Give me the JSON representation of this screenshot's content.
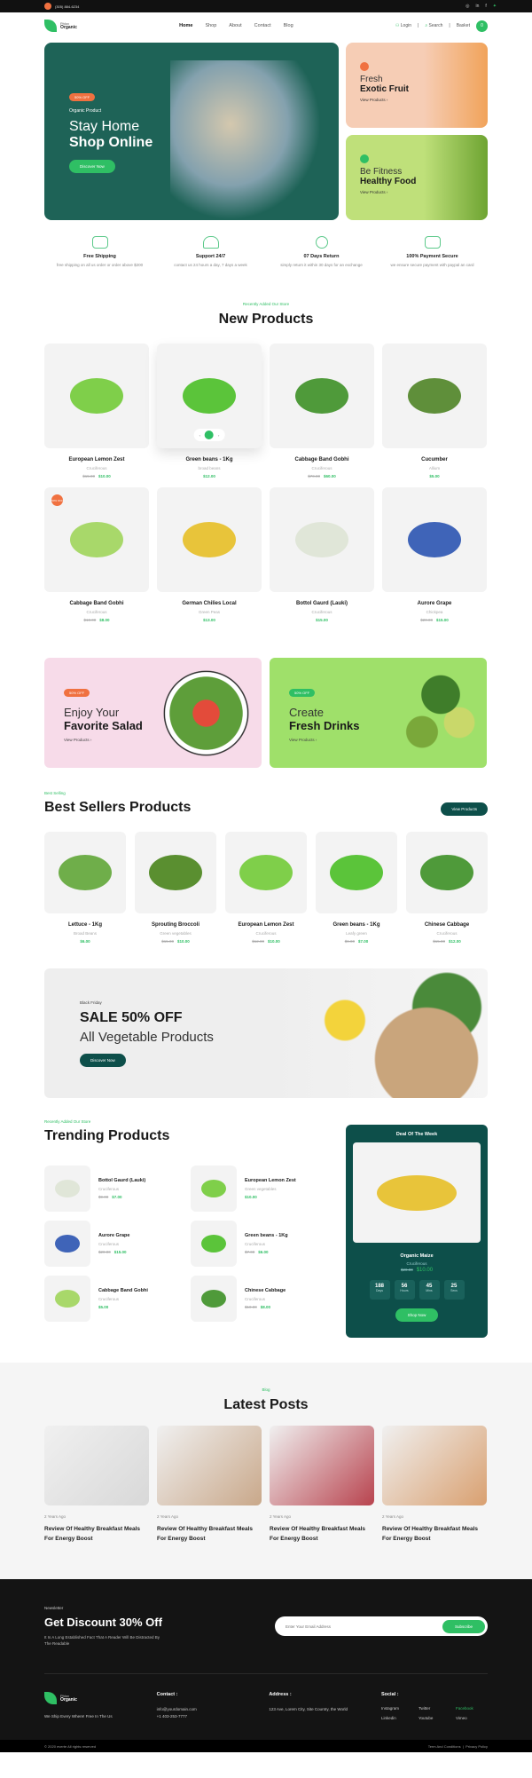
{
  "topbar": {
    "phone": "(305) 884-6234",
    "social": [
      "instagram-icon",
      "linkedin-icon",
      "facebook-icon",
      "twitter-icon"
    ]
  },
  "header": {
    "logo_top": "Phlox",
    "logo_bottom": "Organic",
    "nav": [
      "Home",
      "Shop",
      "About",
      "Contact",
      "Blog"
    ],
    "login": "Login",
    "search": "Search",
    "basket": "Basket",
    "basket_count": "0"
  },
  "hero": {
    "badge": "50% OFF",
    "subtitle": "Organic Product",
    "title1": "Stay Home",
    "title2": "Shop Online",
    "cta": "Discover Now"
  },
  "side_cards": [
    {
      "line1": "Fresh",
      "line2": "Exotic Fruit",
      "link": "View Products ›"
    },
    {
      "line1": "Be Fitness",
      "line2": "Healthy Food",
      "link": "View Products ›"
    }
  ],
  "features": [
    {
      "title": "Free Shipping",
      "desc": "free shipping on all us order or order above $200"
    },
    {
      "title": "Support 24/7",
      "desc": "contact us 24 hours a day, 7 days a week"
    },
    {
      "title": "07 Days Return",
      "desc": "simply return it within 30 days for an exchange"
    },
    {
      "title": "100% Payment Secure",
      "desc": "we ensure secure payment with paypal an card"
    }
  ],
  "new_products": {
    "eyebrow": "Recently Added Our Store",
    "title": "New Products",
    "items": [
      {
        "name": "European Lemon Zest",
        "cat": "Cruciferous",
        "old": "$15.00",
        "price": "$10.00",
        "color": "#7fcf4a"
      },
      {
        "name": "Green beans - 1Kg",
        "cat": "broad beans",
        "old": "",
        "price": "$12.00",
        "color": "#5bc43a"
      },
      {
        "name": "Cabbage Band Gobhi",
        "cat": "Cruciferous",
        "old": "$70.00",
        "price": "$60.00",
        "color": "#4f9a3a"
      },
      {
        "name": "Cucumber",
        "cat": "Allium",
        "old": "",
        "price": "$5.00",
        "color": "#5f8f3a"
      },
      {
        "name": "Cabbage Band Gobhi",
        "cat": "Cruciferous",
        "old": "$10.00",
        "price": "$8.00",
        "color": "#a8d86a",
        "sale": "50% OFF"
      },
      {
        "name": "German Chilies Local",
        "cat": "Green Peas",
        "old": "",
        "price": "$13.00",
        "color": "#e8c43a"
      },
      {
        "name": "Bottol Gaurd (Lauki)",
        "cat": "Cruciferous",
        "old": "",
        "price": "$15.00",
        "color": "#e0e6d8"
      },
      {
        "name": "Aurore Grape",
        "cat": "Chickpea",
        "old": "$20.00",
        "price": "$15.00",
        "color": "#3f64b8"
      }
    ],
    "controls": [
      "‹",
      "›"
    ]
  },
  "promos": [
    {
      "badge": "50% OFF",
      "line1": "Enjoy Your",
      "line2": "Favorite Salad",
      "link": "View Products ›"
    },
    {
      "badge": "50% OFF",
      "line1": "Create",
      "line2": "Fresh Drinks",
      "link": "View Products ›"
    }
  ],
  "best_sellers": {
    "eyebrow": "Best Selling",
    "title": "Best Sellers Products",
    "button": "View Products",
    "items": [
      {
        "name": "Lettuce - 1Kg",
        "cat": "Broad Beans",
        "old": "",
        "price": "$6.00",
        "color": "#6fae4a"
      },
      {
        "name": "Sprouting Broccoli",
        "cat": "Green vegetables",
        "old": "$15.00",
        "price": "$10.00",
        "color": "#5a8f30"
      },
      {
        "name": "European Lemon Zest",
        "cat": "Cruciferous",
        "old": "$12.00",
        "price": "$10.00",
        "color": "#7fcf4a"
      },
      {
        "name": "Green beans - 1Kg",
        "cat": "Leafy green",
        "old": "$9.00",
        "price": "$7.00",
        "color": "#5bc43a"
      },
      {
        "name": "Chinese Cabbage",
        "cat": "Cruciferous",
        "old": "$15.00",
        "price": "$12.00",
        "color": "#4f9a3a"
      }
    ]
  },
  "sale_banner": {
    "eyebrow": "Black Friday",
    "title": "SALE 50% OFF",
    "subtitle": "All Vegetable Products",
    "button": "Discover Now"
  },
  "trending": {
    "eyebrow": "Recently Added Our Store",
    "title": "Trending Products",
    "items": [
      {
        "name": "Bottol Gaurd (Lauki)",
        "cat": "Cruciferous",
        "old": "$9.00",
        "price": "$7.00",
        "color": "#e0e6d8"
      },
      {
        "name": "European Lemon Zest",
        "cat": "Green vegetables",
        "old": "",
        "price": "$10.00",
        "color": "#7fcf4a"
      },
      {
        "name": "Aurore Grape",
        "cat": "Cruciferous",
        "old": "$20.00",
        "price": "$15.00",
        "color": "#3f64b8"
      },
      {
        "name": "Green beans - 1Kg",
        "cat": "Cruciferous",
        "old": "$7.00",
        "price": "$6.00",
        "color": "#5bc43a"
      },
      {
        "name": "Cabbage Band Gobhi",
        "cat": "Cruciferous",
        "old": "",
        "price": "$5.00",
        "color": "#a8d86a"
      },
      {
        "name": "Chinese Cabbage",
        "cat": "Cruciferous",
        "old": "$10.00",
        "price": "$8.00",
        "color": "#4f9a3a"
      }
    ]
  },
  "deal": {
    "title": "Deal Of The Week",
    "name": "Organic Maize",
    "cat": "Cruciferous",
    "old": "$20.00",
    "price": "$10.00",
    "timer": [
      {
        "value": "188",
        "label": "Days"
      },
      {
        "value": "56",
        "label": "Hours"
      },
      {
        "value": "45",
        "label": "Mins"
      },
      {
        "value": "25",
        "label": "Secs"
      }
    ],
    "button": "Shop Now"
  },
  "posts": {
    "eyebrow": "Blog",
    "title": "Latest Posts",
    "items": [
      {
        "date": "2 Years Ago",
        "title": "Review Of Healthy Breakfast Meals For Energy Boost",
        "color": "#d8d8d8"
      },
      {
        "date": "2 Years Ago",
        "title": "Review Of Healthy Breakfast Meals For Energy Boost",
        "color": "#c9a88a"
      },
      {
        "date": "2 Years Ago",
        "title": "Review Of Healthy Breakfast Meals For Energy Boost",
        "color": "#b8434e"
      },
      {
        "date": "2 Years Ago",
        "title": "Review Of Healthy Breakfast Meals For Energy Boost",
        "color": "#d9a070"
      }
    ]
  },
  "newsletter": {
    "eyebrow": "Newsletter",
    "title": "Get Discount 30% Off",
    "desc": "It Is A Long Established Fact That A Reader Will Be Distracted By The Readable",
    "placeholder": "Enter Your Email Address",
    "button": "Subscribe"
  },
  "footer": {
    "tagline": "We Ship Every Where! Free In The Us",
    "contact_title": "Contact :",
    "email": "info@yourdomain.com",
    "phone": "+1 403-253-7777",
    "address_title": "Address :",
    "address": "123 Ave, Lorem City, Site Country, the World",
    "social_title": "Social :",
    "social": [
      "Instagram",
      "Twitter",
      "Facebook",
      "Linkedin",
      "Youtube",
      "Vimeo"
    ],
    "copyright": "© 2020 everte All rights reserved",
    "terms": "Term And Conditions",
    "privacy": "Privacy Policy"
  }
}
